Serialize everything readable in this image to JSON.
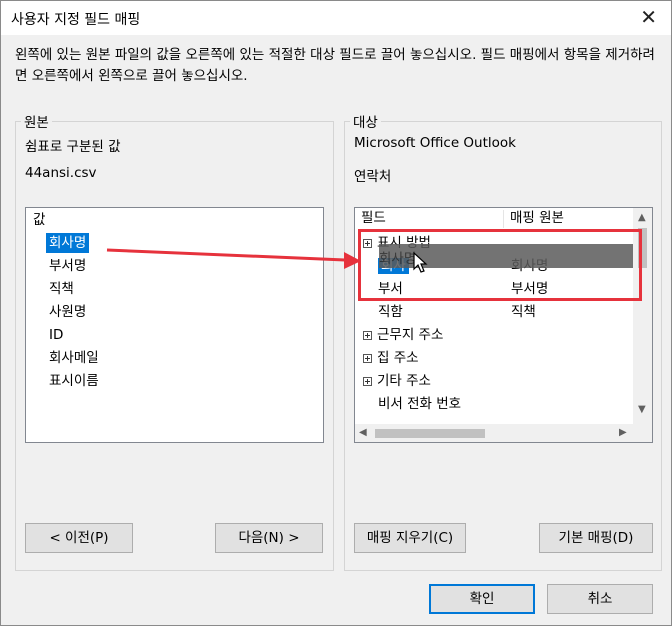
{
  "window": {
    "title": "사용자 지정 필드 매핑",
    "close_label": "✕"
  },
  "instructions": "왼쪽에 있는 원본 파일의 값을 오른쪽에 있는 적절한 대상 필드로 끌어 놓으십시오. 필드 매핑에서 항목을 제거하려면 오른쪽에서 왼쪽으로 끌어 놓으십시오.",
  "source": {
    "group_label": "원본",
    "type_label": "쉼표로 구분된 값",
    "file_name": "44ansi.csv",
    "list_header": "값",
    "items": [
      "회사명",
      "부서명",
      "직책",
      "사원명",
      "ID",
      "회사메일",
      "표시이름"
    ],
    "selected_index": 0,
    "prev_button": "< 이전(P)",
    "next_button": "다음(N) >"
  },
  "target": {
    "group_label": "대상",
    "app_name": "Microsoft Office Outlook",
    "folder_name": "연락처",
    "columns": [
      "필드",
      "매핑 원본"
    ],
    "rows": [
      {
        "field": "표시 방법",
        "mapped": "",
        "expandable": true,
        "selected": false
      },
      {
        "field": "회사",
        "mapped": "회사명",
        "expandable": false,
        "selected": true
      },
      {
        "field": "부서",
        "mapped": "부서명",
        "expandable": false,
        "selected": false
      },
      {
        "field": "직함",
        "mapped": "직책",
        "expandable": false,
        "selected": false
      },
      {
        "field": "근무지 주소",
        "mapped": "",
        "expandable": true,
        "selected": false
      },
      {
        "field": "집 주소",
        "mapped": "",
        "expandable": true,
        "selected": false
      },
      {
        "field": "기타 주소",
        "mapped": "",
        "expandable": true,
        "selected": false
      },
      {
        "field": "비서 전화 번호",
        "mapped": "",
        "expandable": false,
        "selected": false
      }
    ],
    "drag_ghost_text": "회사명",
    "clear_button": "매핑 지우기(C)",
    "default_button": "기본 매핑(D)"
  },
  "footer": {
    "ok_button": "확인",
    "cancel_button": "취소"
  },
  "annotation": {
    "color": "#e6323c"
  },
  "colors": {
    "selection": "#0078d7",
    "default_button_border": "#0078d7"
  }
}
